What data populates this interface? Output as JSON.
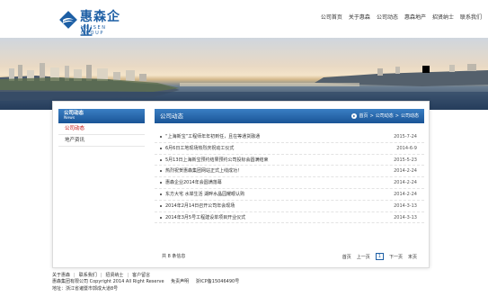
{
  "header": {
    "logo_cn": "惠森企业",
    "logo_en": "HUISEN GROUP",
    "nav": [
      "公司首页",
      "关于惠森",
      "公司动态",
      "惠森地产",
      "招贤纳士",
      "联系我们"
    ]
  },
  "sidebar": {
    "title": "公司动态",
    "title_en": "News",
    "items": [
      {
        "label": "公司动态",
        "active": true
      },
      {
        "label": "地产资讯",
        "active": false
      }
    ]
  },
  "main": {
    "title": "公司动态",
    "breadcrumb": [
      "首页",
      "公司动态",
      "公司动态"
    ],
    "articles": [
      {
        "title": "“上海新宝”工程师年年初到任，且在等通货融通",
        "date": "2015-7-24"
      },
      {
        "title": "6月6日工地现场热烈庆祝动工仪式",
        "date": "2014-6-9"
      },
      {
        "title": "5月13日上海新宝预约结果预约公司投标会圆满结束",
        "date": "2015-5-23"
      },
      {
        "title": "热烈祝贺惠森集团网站正式上线成功！",
        "date": "2014-2-24"
      },
      {
        "title": "惠森企业2014年会圆满落幕",
        "date": "2014-2-24"
      },
      {
        "title": "东方大宅 水岸生活 湖畔水晶园耀眼认购",
        "date": "2014-2-24"
      },
      {
        "title": "2014年2月14日召开公司年会现场",
        "date": "2014-3-13"
      },
      {
        "title": "2014年3月5号工程建设单项目开业仪式",
        "date": "2014-3-13"
      }
    ],
    "total_text": "共 8 条信息",
    "pager": {
      "first": "首页",
      "prev": "上一页",
      "current": "1",
      "next": "下一页",
      "last": "末页"
    }
  },
  "footer": {
    "links": [
      "关于惠森",
      "联系我们",
      "招贤纳士",
      "客户留言"
    ],
    "copyright": "惠森集团有限公司  Copyright 2014 All Right Reserve",
    "disclaimer": "免责声明",
    "icp": "浙ICP备15046490号",
    "address": "地址：浙江省诸暨市郭成大道8号"
  },
  "colors": {
    "brand": "#1d5fa5",
    "active": "#c00000"
  }
}
